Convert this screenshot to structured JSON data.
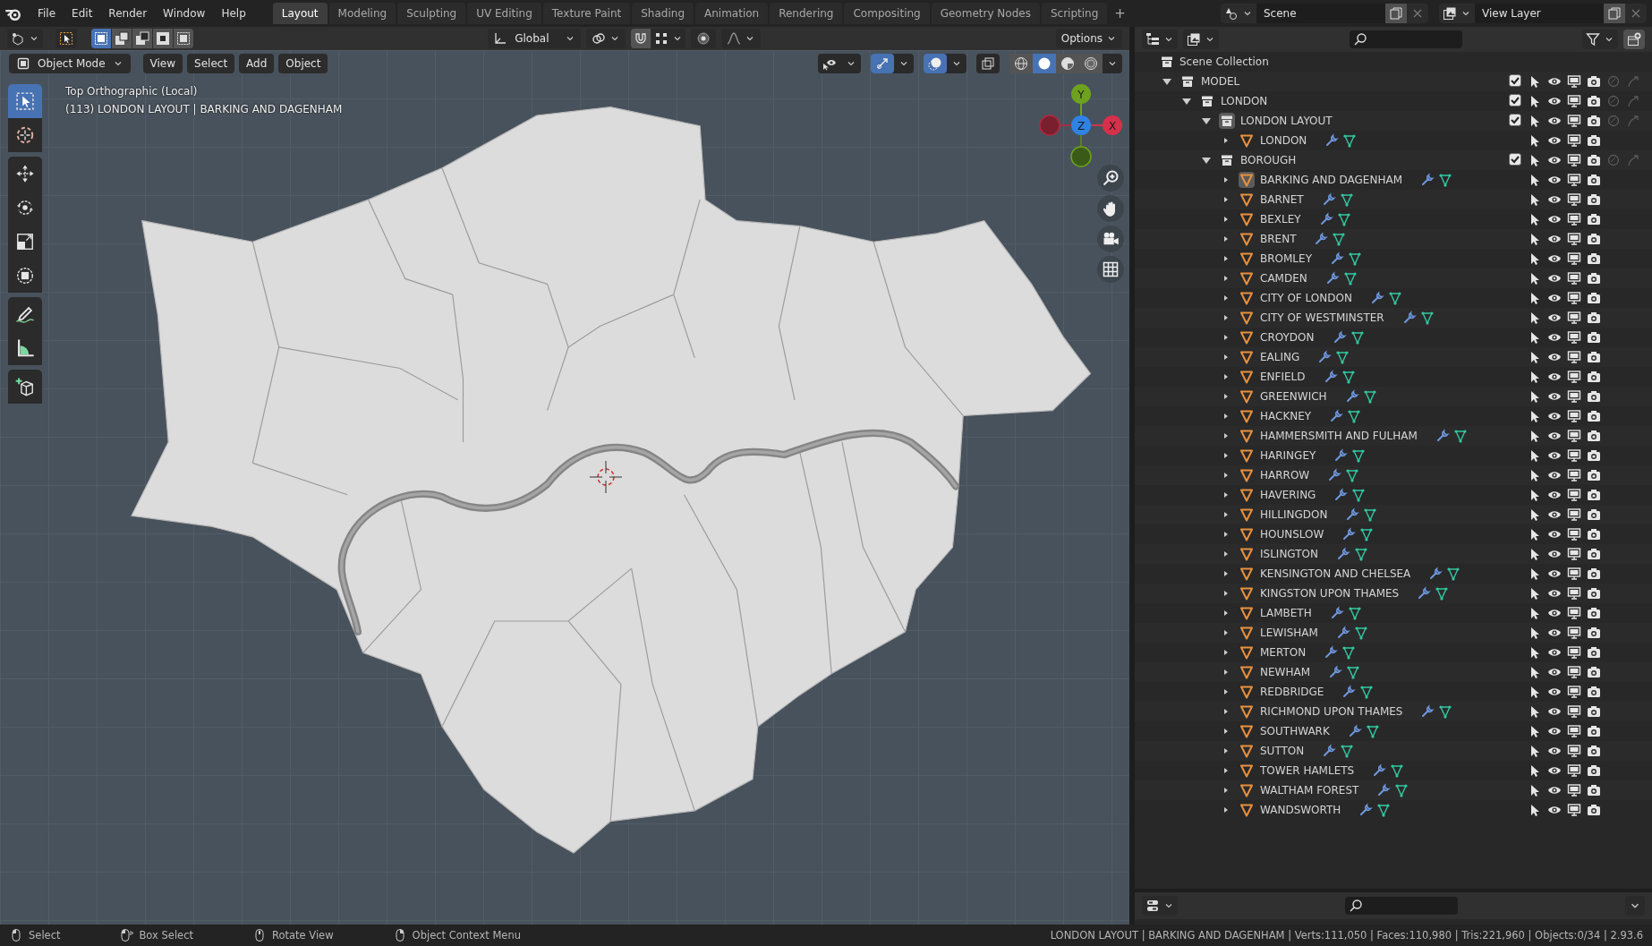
{
  "menu": [
    {
      "label": "File"
    },
    {
      "label": "Edit"
    },
    {
      "label": "Render"
    },
    {
      "label": "Window"
    },
    {
      "label": "Help"
    }
  ],
  "workspaces": [
    {
      "label": "Layout",
      "selected": true
    },
    {
      "label": "Modeling",
      "selected": false
    },
    {
      "label": "Sculpting",
      "selected": false
    },
    {
      "label": "UV Editing",
      "selected": false
    },
    {
      "label": "Texture Paint",
      "selected": false
    },
    {
      "label": "Shading",
      "selected": false
    },
    {
      "label": "Animation",
      "selected": false
    },
    {
      "label": "Rendering",
      "selected": false
    },
    {
      "label": "Compositing",
      "selected": false
    },
    {
      "label": "Geometry Nodes",
      "selected": false
    },
    {
      "label": "Scripting",
      "selected": false
    }
  ],
  "add_workspace": "+",
  "scene": {
    "name": "Scene"
  },
  "view_layer": {
    "name": "View Layer"
  },
  "tool_header": {
    "select_modes": [
      {
        "selected": true
      },
      {
        "selected": false
      },
      {
        "selected": false
      },
      {
        "selected": false
      },
      {
        "selected": false
      }
    ],
    "orientation": "Global",
    "options": "Options"
  },
  "viewport": {
    "mode": "Object Mode",
    "menus": [
      "View",
      "Select",
      "Add",
      "Object"
    ],
    "toggles": [
      {
        "kind": "visibility",
        "selected": false
      },
      {
        "kind": "gizmo",
        "selected": true
      },
      {
        "kind": "overlay",
        "selected": true
      },
      {
        "kind": "xray",
        "selected": false
      }
    ],
    "shading": [
      {
        "kind": "wireframe",
        "selected": false
      },
      {
        "kind": "solid",
        "selected": true
      },
      {
        "kind": "material",
        "selected": false
      },
      {
        "kind": "rendered",
        "selected": false
      }
    ],
    "info": [
      "Top Orthographic (Local)",
      "(113) LONDON LAYOUT | BARKING AND DAGENHAM"
    ],
    "axes": [
      {
        "label": "Y",
        "color": "#6ea21e"
      },
      {
        "label": "X",
        "color": "#d7304a"
      },
      {
        "label": "Z",
        "color": "#2f83e3"
      }
    ],
    "tools": [
      {
        "kind": "select",
        "selected": true
      },
      {
        "kind": "cursor",
        "selected": false
      },
      {
        "kind": "move",
        "selected": false
      },
      {
        "kind": "rotate",
        "selected": false
      },
      {
        "kind": "scale",
        "selected": false
      },
      {
        "kind": "transform",
        "selected": false
      },
      {
        "kind": "annotate",
        "selected": false
      },
      {
        "kind": "measure",
        "selected": false
      },
      {
        "kind": "add_cube",
        "selected": false
      }
    ]
  },
  "outliner": {
    "root": "Scene Collection",
    "tree": [
      {
        "name": "MODEL",
        "kind": "collection",
        "expanded": true,
        "checked": true,
        "active": false,
        "children": [
          {
            "name": "LONDON",
            "kind": "collection",
            "expanded": true,
            "checked": true,
            "active": false,
            "children": [
              {
                "name": "LONDON LAYOUT",
                "kind": "collection",
                "expanded": true,
                "checked": true,
                "active": true,
                "children": [
                  {
                    "name": "LONDON",
                    "kind": "mesh",
                    "expanded": false,
                    "active": false
                  }
                ]
              },
              {
                "name": "BOROUGH",
                "kind": "collection",
                "expanded": true,
                "checked": true,
                "active": false,
                "children": [
                  {
                    "name": "BARKING AND DAGENHAM",
                    "kind": "mesh",
                    "expanded": false,
                    "active": true
                  },
                  {
                    "name": "BARNET",
                    "kind": "mesh",
                    "expanded": false,
                    "active": false
                  },
                  {
                    "name": "BEXLEY",
                    "kind": "mesh",
                    "expanded": false,
                    "active": false
                  },
                  {
                    "name": "BRENT",
                    "kind": "mesh",
                    "expanded": false,
                    "active": false
                  },
                  {
                    "name": "BROMLEY",
                    "kind": "mesh",
                    "expanded": false,
                    "active": false
                  },
                  {
                    "name": "CAMDEN",
                    "kind": "mesh",
                    "expanded": false,
                    "active": false
                  },
                  {
                    "name": "CITY OF LONDON",
                    "kind": "mesh",
                    "expanded": false,
                    "active": false
                  },
                  {
                    "name": "CITY OF WESTMINSTER",
                    "kind": "mesh",
                    "expanded": false,
                    "active": false
                  },
                  {
                    "name": "CROYDON",
                    "kind": "mesh",
                    "expanded": false,
                    "active": false
                  },
                  {
                    "name": "EALING",
                    "kind": "mesh",
                    "expanded": false,
                    "active": false
                  },
                  {
                    "name": "ENFIELD",
                    "kind": "mesh",
                    "expanded": false,
                    "active": false
                  },
                  {
                    "name": "GREENWICH",
                    "kind": "mesh",
                    "expanded": false,
                    "active": false
                  },
                  {
                    "name": "HACKNEY",
                    "kind": "mesh",
                    "expanded": false,
                    "active": false
                  },
                  {
                    "name": "HAMMERSMITH AND FULHAM",
                    "kind": "mesh",
                    "expanded": false,
                    "active": false
                  },
                  {
                    "name": "HARINGEY",
                    "kind": "mesh",
                    "expanded": false,
                    "active": false
                  },
                  {
                    "name": "HARROW",
                    "kind": "mesh",
                    "expanded": false,
                    "active": false
                  },
                  {
                    "name": "HAVERING",
                    "kind": "mesh",
                    "expanded": false,
                    "active": false
                  },
                  {
                    "name": "HILLINGDON",
                    "kind": "mesh",
                    "expanded": false,
                    "active": false
                  },
                  {
                    "name": "HOUNSLOW",
                    "kind": "mesh",
                    "expanded": false,
                    "active": false
                  },
                  {
                    "name": "ISLINGTON",
                    "kind": "mesh",
                    "expanded": false,
                    "active": false
                  },
                  {
                    "name": "KENSINGTON AND CHELSEA",
                    "kind": "mesh",
                    "expanded": false,
                    "active": false
                  },
                  {
                    "name": "KINGSTON UPON THAMES",
                    "kind": "mesh",
                    "expanded": false,
                    "active": false
                  },
                  {
                    "name": "LAMBETH",
                    "kind": "mesh",
                    "expanded": false,
                    "active": false
                  },
                  {
                    "name": "LEWISHAM",
                    "kind": "mesh",
                    "expanded": false,
                    "active": false
                  },
                  {
                    "name": "MERTON",
                    "kind": "mesh",
                    "expanded": false,
                    "active": false
                  },
                  {
                    "name": "NEWHAM",
                    "kind": "mesh",
                    "expanded": false,
                    "active": false
                  },
                  {
                    "name": "REDBRIDGE",
                    "kind": "mesh",
                    "expanded": false,
                    "active": false
                  },
                  {
                    "name": "RICHMOND UPON THAMES",
                    "kind": "mesh",
                    "expanded": false,
                    "active": false
                  },
                  {
                    "name": "SOUTHWARK",
                    "kind": "mesh",
                    "expanded": false,
                    "active": false
                  },
                  {
                    "name": "SUTTON",
                    "kind": "mesh",
                    "expanded": false,
                    "active": false
                  },
                  {
                    "name": "TOWER HAMLETS",
                    "kind": "mesh",
                    "expanded": false,
                    "active": false
                  },
                  {
                    "name": "WALTHAM FOREST",
                    "kind": "mesh",
                    "expanded": false,
                    "active": false
                  },
                  {
                    "name": "WANDSWORTH",
                    "kind": "mesh",
                    "expanded": false,
                    "active": false
                  }
                ]
              }
            ]
          }
        ]
      }
    ]
  },
  "status_bar": {
    "hints": [
      {
        "kind": "left",
        "label": "Select"
      },
      {
        "kind": "drag",
        "label": "Box Select"
      },
      {
        "kind": "middle",
        "label": "Rotate View"
      },
      {
        "kind": "right",
        "label": "Object Context Menu"
      }
    ],
    "stats": "LONDON LAYOUT | BARKING AND DAGENHAM | Verts:111,050 | Faces:110,980 | Tris:221,960 | Objects:0/34 | 2.93.6"
  }
}
